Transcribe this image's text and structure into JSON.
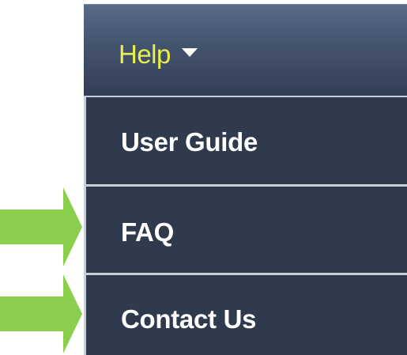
{
  "menu": {
    "title": "Help",
    "caret_icon": "caret-down-icon",
    "items": [
      {
        "label": "User Guide"
      },
      {
        "label": "FAQ"
      },
      {
        "label": "Contact Us"
      }
    ]
  },
  "annotations": {
    "arrow_icon": "arrow-right-icon",
    "arrow_color": "#8bcf4f",
    "highlighted_items": [
      "FAQ",
      "Contact Us"
    ]
  },
  "colors": {
    "menu_background": "#2f3a4d",
    "help_label": "#e6f04a",
    "divider": "#c7cfdb"
  }
}
